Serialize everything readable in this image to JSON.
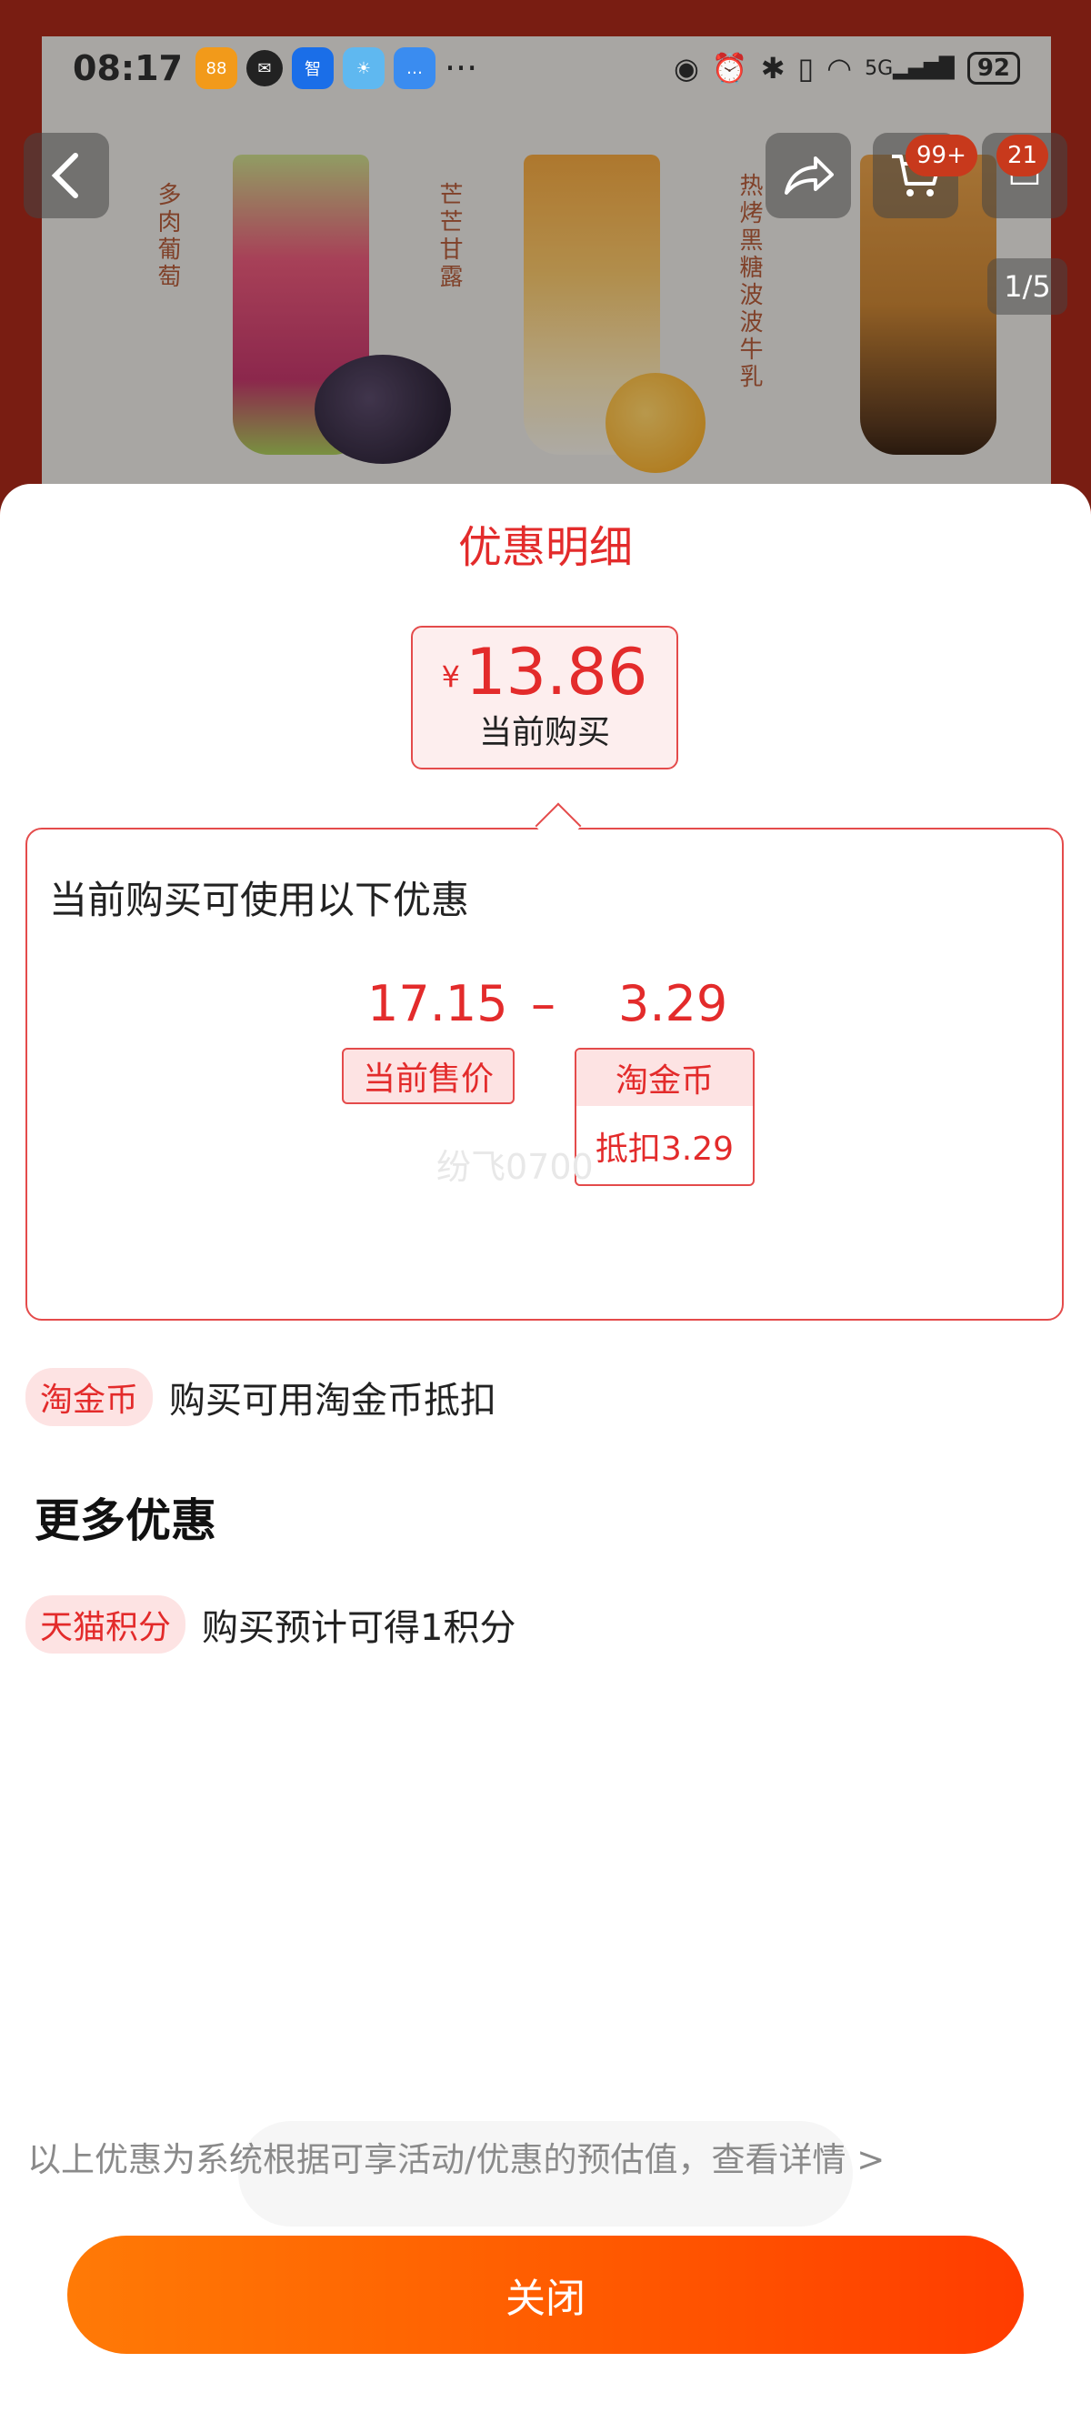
{
  "status_bar": {
    "time": "08:17",
    "battery": "92",
    "network": "5G"
  },
  "product_banner": {
    "labels": [
      "多肉葡萄",
      "芒芒甘露",
      "热烤黑糖波波牛乳"
    ],
    "cart_badge": "99+",
    "message_badge": "21",
    "pager": "1/5"
  },
  "sheet": {
    "title": "优惠明细",
    "price": {
      "symbol": "¥",
      "value": "13.86",
      "label": "当前购买"
    },
    "detail": {
      "heading": "当前购买可使用以下优惠",
      "current_price": "17.15",
      "minus": "–",
      "coin_value": "3.29",
      "current_price_label": "当前售价",
      "coin_label": "淘金币",
      "coin_deduct": "抵扣3.29",
      "watermark": "纷飞0700"
    },
    "coin_row": {
      "tag": "淘金币",
      "text": "购买可用淘金币抵扣"
    },
    "more_title": "更多优惠",
    "points_row": {
      "tag": "天猫积分",
      "text": "购买预计可得1积分"
    },
    "footnote": "以上优惠为系统根据可享活动/优惠的预估值，查看详情 >",
    "close_label": "关闭"
  },
  "colors": {
    "accent_red": "#e32b2b",
    "close_gradient_start": "#ff7a06",
    "close_gradient_end": "#ff3c00"
  }
}
